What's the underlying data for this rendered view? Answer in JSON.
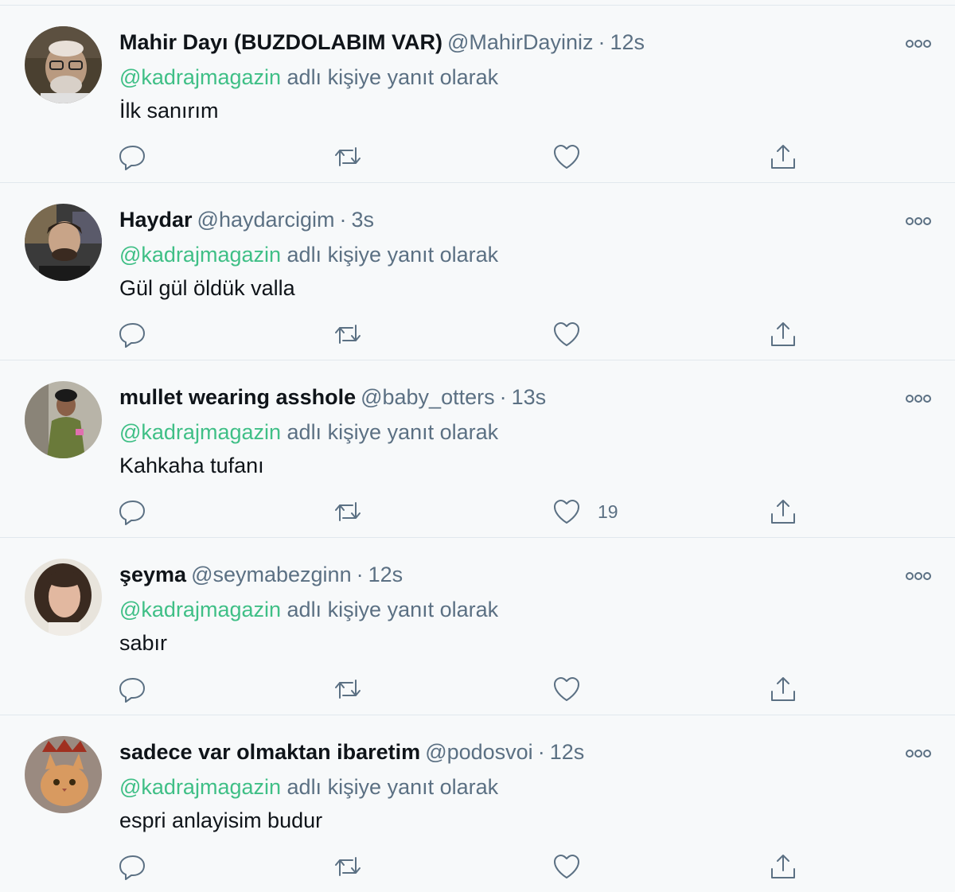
{
  "reply_prefix_suffix": "adlı kişiye yanıt olarak",
  "colors": {
    "mention": "#3fbf86",
    "secondary_text": "#5b7083",
    "background": "#f7f9fa"
  },
  "tweets": [
    {
      "name": "Mahir Dayı (BUZDOLABIM VAR)",
      "handle": "@MahirDayiniz",
      "separator": "·",
      "time": "12s",
      "reply_to": "@kadrajmagazin",
      "reply_text": "adlı kişiye yanıt olarak",
      "text": "İlk sanırım",
      "like_count": "",
      "avatar": "avatar-older-man-glasses"
    },
    {
      "name": "Haydar",
      "handle": "@haydarcigim",
      "separator": "·",
      "time": "3s",
      "reply_to": "@kadrajmagazin",
      "reply_text": "adlı kişiye yanıt olarak",
      "text": "Gül gül öldük valla",
      "like_count": "",
      "avatar": "avatar-young-man"
    },
    {
      "name": "mullet wearing asshole",
      "handle": "@baby_otters",
      "separator": "·",
      "time": "13s",
      "reply_to": "@kadrajmagazin",
      "reply_text": "adlı kişiye yanıt olarak",
      "text": "Kahkaha tufanı",
      "like_count": "19",
      "avatar": "avatar-person-green-jacket"
    },
    {
      "name": "şeyma",
      "handle": "@seymabezginn",
      "separator": "·",
      "time": "12s",
      "reply_to": "@kadrajmagazin",
      "reply_text": "adlı kişiye yanıt olarak",
      "text": "sabır",
      "like_count": "",
      "avatar": "avatar-woman-curly-hair"
    },
    {
      "name": "sadece var olmaktan ibaretim",
      "handle": "@podosvoi",
      "separator": "·",
      "time": "12s",
      "reply_to": "@kadrajmagazin",
      "reply_text": "adlı kişiye yanıt olarak",
      "text": "espri anlayisim budur",
      "like_count": "",
      "avatar": "avatar-cat-with-crown"
    }
  ],
  "icons": {
    "reply": "reply-icon",
    "retweet": "retweet-icon",
    "like": "heart-icon",
    "share": "share-icon",
    "more": "more-options-icon"
  }
}
